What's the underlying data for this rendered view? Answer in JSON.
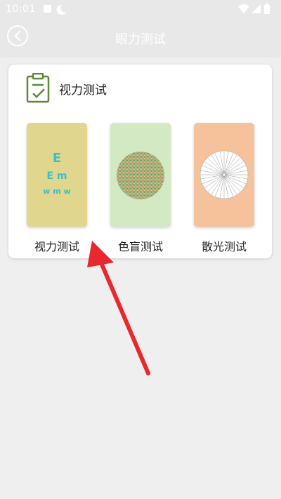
{
  "status_bar": {
    "time": "10:01",
    "left_icons": [
      "notification-icon",
      "do-not-disturb-moon-icon"
    ],
    "right_icons": [
      "wifi-icon",
      "signal-icon",
      "battery-icon"
    ]
  },
  "header": {
    "title": "眼力测试",
    "back_icon": "back-arrow-icon"
  },
  "section": {
    "title": "视力测试",
    "icon": "clipboard-check-icon"
  },
  "tiles": [
    {
      "label": "视力测试",
      "color": "#e0d68e",
      "icon": "eye-chart-icon"
    },
    {
      "label": "色盲测试",
      "color": "#d3e9c3",
      "icon": "color-blind-plate-icon"
    },
    {
      "label": "散光测试",
      "color": "#f5c29b",
      "icon": "astigmatism-dial-icon"
    }
  ],
  "colors": {
    "accent_green": "#5a8a3a",
    "eye_chart": "#3cc0c6",
    "arrow": "#e8282e"
  }
}
